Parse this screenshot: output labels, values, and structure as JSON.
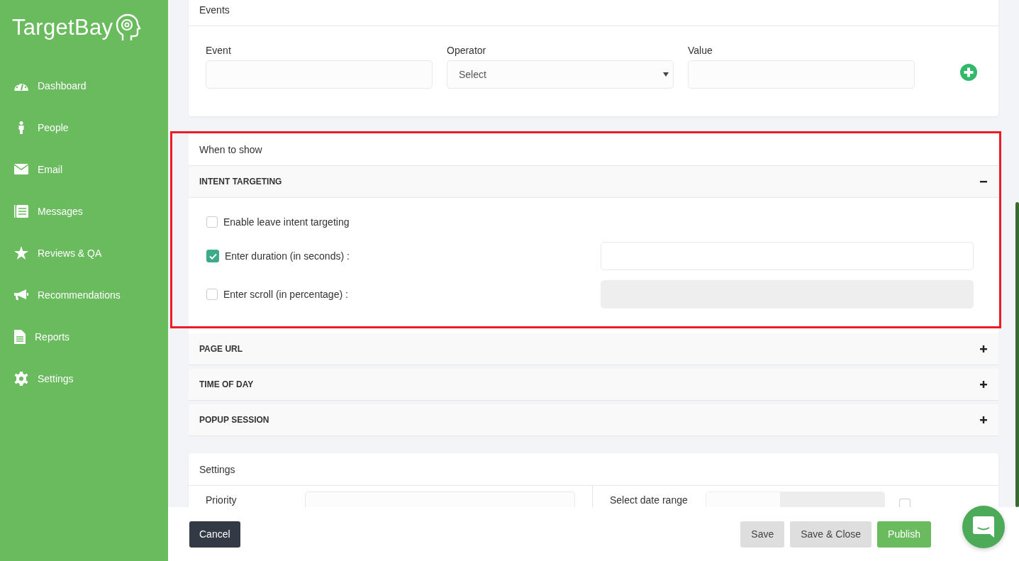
{
  "sidebar": {
    "logo": "TargetBay",
    "items": [
      {
        "label": "Dashboard"
      },
      {
        "label": "People"
      },
      {
        "label": "Email"
      },
      {
        "label": "Messages"
      },
      {
        "label": "Reviews & QA"
      },
      {
        "label": "Recommendations"
      },
      {
        "label": "Reports"
      },
      {
        "label": "Settings"
      }
    ]
  },
  "events": {
    "title": "Events",
    "fields": [
      {
        "label": "Event",
        "kind": "input"
      },
      {
        "label": "Operator",
        "kind": "select",
        "value": "Select"
      },
      {
        "label": "Value",
        "kind": "input"
      }
    ]
  },
  "when_to_show": {
    "title": "When to show",
    "highlighted": true,
    "sections": [
      {
        "title": "INTENT TARGETING",
        "expanded": true,
        "options": [
          {
            "label": "Enable leave intent targeting",
            "checked": false,
            "has_field": false
          },
          {
            "label": "Enter duration (in seconds) :",
            "checked": true,
            "has_field": true
          },
          {
            "label": "Enter scroll (in percentage) :",
            "checked": false,
            "has_field": true
          }
        ]
      },
      {
        "title": "PAGE URL",
        "expanded": false
      },
      {
        "title": "TIME OF DAY",
        "expanded": false
      },
      {
        "title": "POPUP SESSION",
        "expanded": false
      }
    ]
  },
  "settings": {
    "title": "Settings",
    "priority_label": "Priority",
    "date_range_label": "Select date range",
    "checkbox_checked": false
  },
  "footer": {
    "cancel": "Cancel",
    "buttons": [
      {
        "label": "Save",
        "kind": "secondary"
      },
      {
        "label": "Save & Close",
        "kind": "secondary"
      },
      {
        "label": "Publish",
        "kind": "primary"
      }
    ]
  }
}
